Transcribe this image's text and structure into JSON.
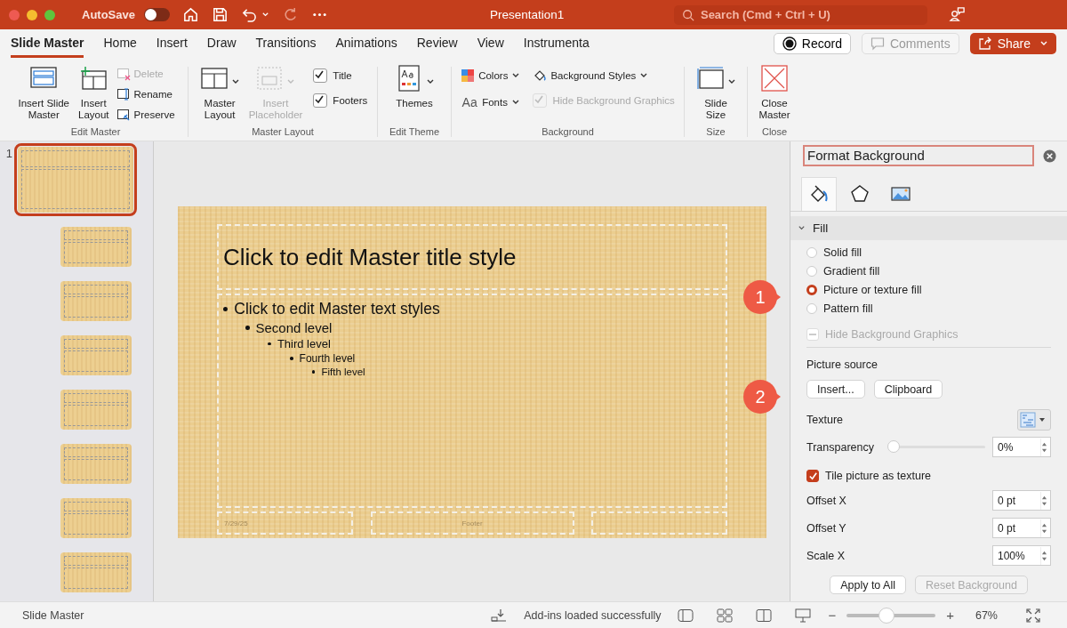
{
  "title_bar": {
    "autosave_label": "AutoSave",
    "autosave_on": false,
    "title": "Presentation1",
    "search_placeholder": "Search (Cmd + Ctrl + U)"
  },
  "tabs": [
    {
      "label": "Slide Master",
      "selected": true
    },
    {
      "label": "Home",
      "selected": false
    },
    {
      "label": "Insert",
      "selected": false
    },
    {
      "label": "Draw",
      "selected": false
    },
    {
      "label": "Transitions",
      "selected": false
    },
    {
      "label": "Animations",
      "selected": false
    },
    {
      "label": "Review",
      "selected": false
    },
    {
      "label": "View",
      "selected": false
    },
    {
      "label": "Instrumenta",
      "selected": false
    }
  ],
  "actions": {
    "record": "Record",
    "comments": {
      "label": "Comments",
      "disabled": true
    },
    "share": "Share"
  },
  "ribbon": {
    "edit_master": {
      "label": "Edit Master",
      "insert_slide_master": [
        "Insert Slide",
        "Master"
      ],
      "insert_layout": [
        "Insert",
        "Layout"
      ],
      "delete": {
        "label": "Delete",
        "disabled": true
      },
      "rename": {
        "label": "Rename",
        "disabled": false
      },
      "preserve": {
        "label": "Preserve",
        "disabled": false
      }
    },
    "master_layout": {
      "label": "Master Layout",
      "master_layout": [
        "Master",
        "Layout"
      ],
      "insert_placeholder": {
        "lines": [
          "Insert",
          "Placeholder"
        ],
        "disabled": true
      },
      "title": {
        "label": "Title",
        "checked": true
      },
      "footers": {
        "label": "Footers",
        "checked": true
      }
    },
    "edit_theme": {
      "label": "Edit Theme",
      "themes": [
        "Themes"
      ]
    },
    "background": {
      "label": "Background",
      "colors": "Colors",
      "fonts_icon": "Aa",
      "fonts": "Fonts",
      "background_styles": "Background Styles",
      "hide_background_graphics": {
        "label": "Hide Background Graphics",
        "checked": true,
        "disabled": true
      }
    },
    "size": {
      "label": "Size",
      "slide_size": [
        "Slide",
        "Size"
      ]
    },
    "close": {
      "label": "Close",
      "close_master": [
        "Close",
        "Master"
      ]
    }
  },
  "thumbnails": [
    {
      "number": "1",
      "selected": true
    },
    {
      "selected": false
    },
    {
      "selected": false
    },
    {
      "selected": false
    },
    {
      "selected": false
    },
    {
      "selected": false
    },
    {
      "selected": false
    },
    {
      "selected": false
    }
  ],
  "slide": {
    "title": "Click to edit Master title style",
    "body": [
      {
        "text": "Click to edit Master text styles",
        "children": [
          {
            "text": "Second level",
            "children": [
              {
                "text": "Third level",
                "children": [
                  {
                    "text": "Fourth level",
                    "children": [
                      {
                        "text": "Fifth level"
                      }
                    ]
                  }
                ]
              }
            ]
          }
        ]
      }
    ],
    "date": "7/29/25",
    "footer": "Footer"
  },
  "panel": {
    "title": "Format Background",
    "tabs": [
      {
        "selected": true
      },
      {
        "selected": false
      },
      {
        "selected": false
      }
    ],
    "section": {
      "label": "Fill",
      "expanded": true
    },
    "fill_options": [
      {
        "label": "Solid fill",
        "selected": false
      },
      {
        "label": "Gradient fill",
        "selected": false
      },
      {
        "label": "Picture or texture fill",
        "selected": true
      },
      {
        "label": "Pattern fill",
        "selected": false
      }
    ],
    "hide_background_graphics": {
      "label": "Hide Background Graphics",
      "checked": false,
      "disabled": true
    },
    "picture_source": "Picture source",
    "insert": "Insert...",
    "clipboard": "Clipboard",
    "texture": "Texture",
    "transparency": {
      "label": "Transparency",
      "level": 0,
      "value": "0%"
    },
    "tile": {
      "label": "Tile picture as texture",
      "checked": true
    },
    "fields": [
      {
        "label": "Offset X",
        "value": "0 pt"
      },
      {
        "label": "Offset Y",
        "value": "0 pt"
      },
      {
        "label": "Scale X",
        "value": "100%"
      }
    ],
    "apply_to_all": "Apply to All",
    "reset_background": {
      "label": "Reset Background",
      "disabled": true
    }
  },
  "callouts": [
    "1",
    "2"
  ],
  "status_bar": {
    "view": "Slide Master",
    "addins": "Add-ins loaded successfully",
    "zoom_out": "−",
    "zoom": {
      "level": 0.45
    },
    "zoom_in": "+",
    "zoom_value": "67%"
  }
}
